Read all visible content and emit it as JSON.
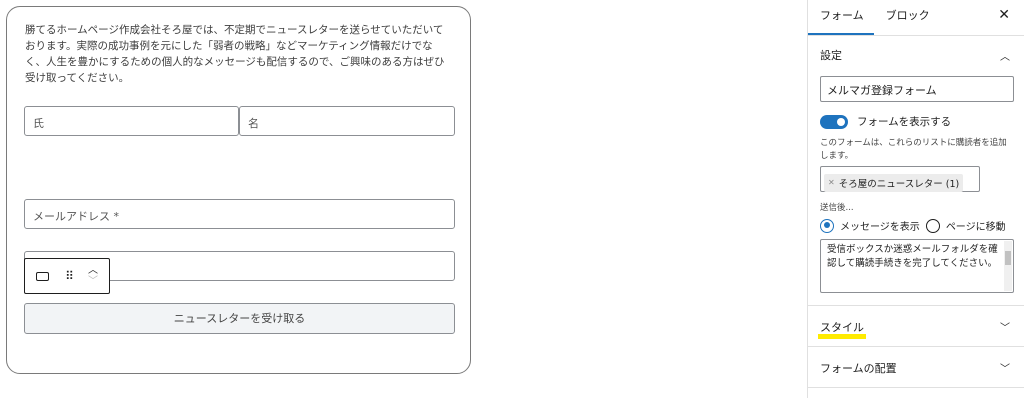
{
  "form": {
    "intro": "勝てるホームページ作成会社そろ屋では、不定期でニュースレターを送らせていただいております。実際の成功事例を元にした「弱者の戦略」などマーケティング情報だけでなく、人生を豊かにするための個人的なメッセージも配信するので、ご興味のある方はぜひ受け取ってください。",
    "first_name_placeholder": "氏",
    "last_name_placeholder": "名",
    "email_placeholder": "メールアドレス *",
    "submit_label": "ニュースレターを受け取る"
  },
  "toolbar": {
    "block_icon": "block-rectangle-icon",
    "drag_icon": "drag-handle-icon",
    "move_up_icon": "chevron-up-icon",
    "move_down_icon": "chevron-down-icon"
  },
  "sidebar": {
    "tabs": [
      {
        "label": "フォーム",
        "active": true
      },
      {
        "label": "ブロック",
        "active": false
      }
    ],
    "close_icon": "close-icon",
    "settings": {
      "title": "設定",
      "form_name": "メルマガ登録フォーム",
      "show_form_label": "フォームを表示する",
      "show_form_enabled": true,
      "list_help": "このフォームは、これらのリストに購読者を追加します。",
      "list_token": "そろ屋のニュースレター (1)",
      "after_submit_label": "送信後...",
      "radio_show_message": "メッセージを表示",
      "radio_redirect": "ページに移動",
      "selected_option": "メッセージを表示",
      "message": "受信ボックスか迷惑メールフォルダを確認して購読手続きを完了してください。"
    },
    "style_title": "スタイル",
    "placement_title": "フォームの配置"
  },
  "colors": {
    "accent": "#1e73be",
    "highlight": "#ffeb00",
    "border": "#8c8f94"
  }
}
